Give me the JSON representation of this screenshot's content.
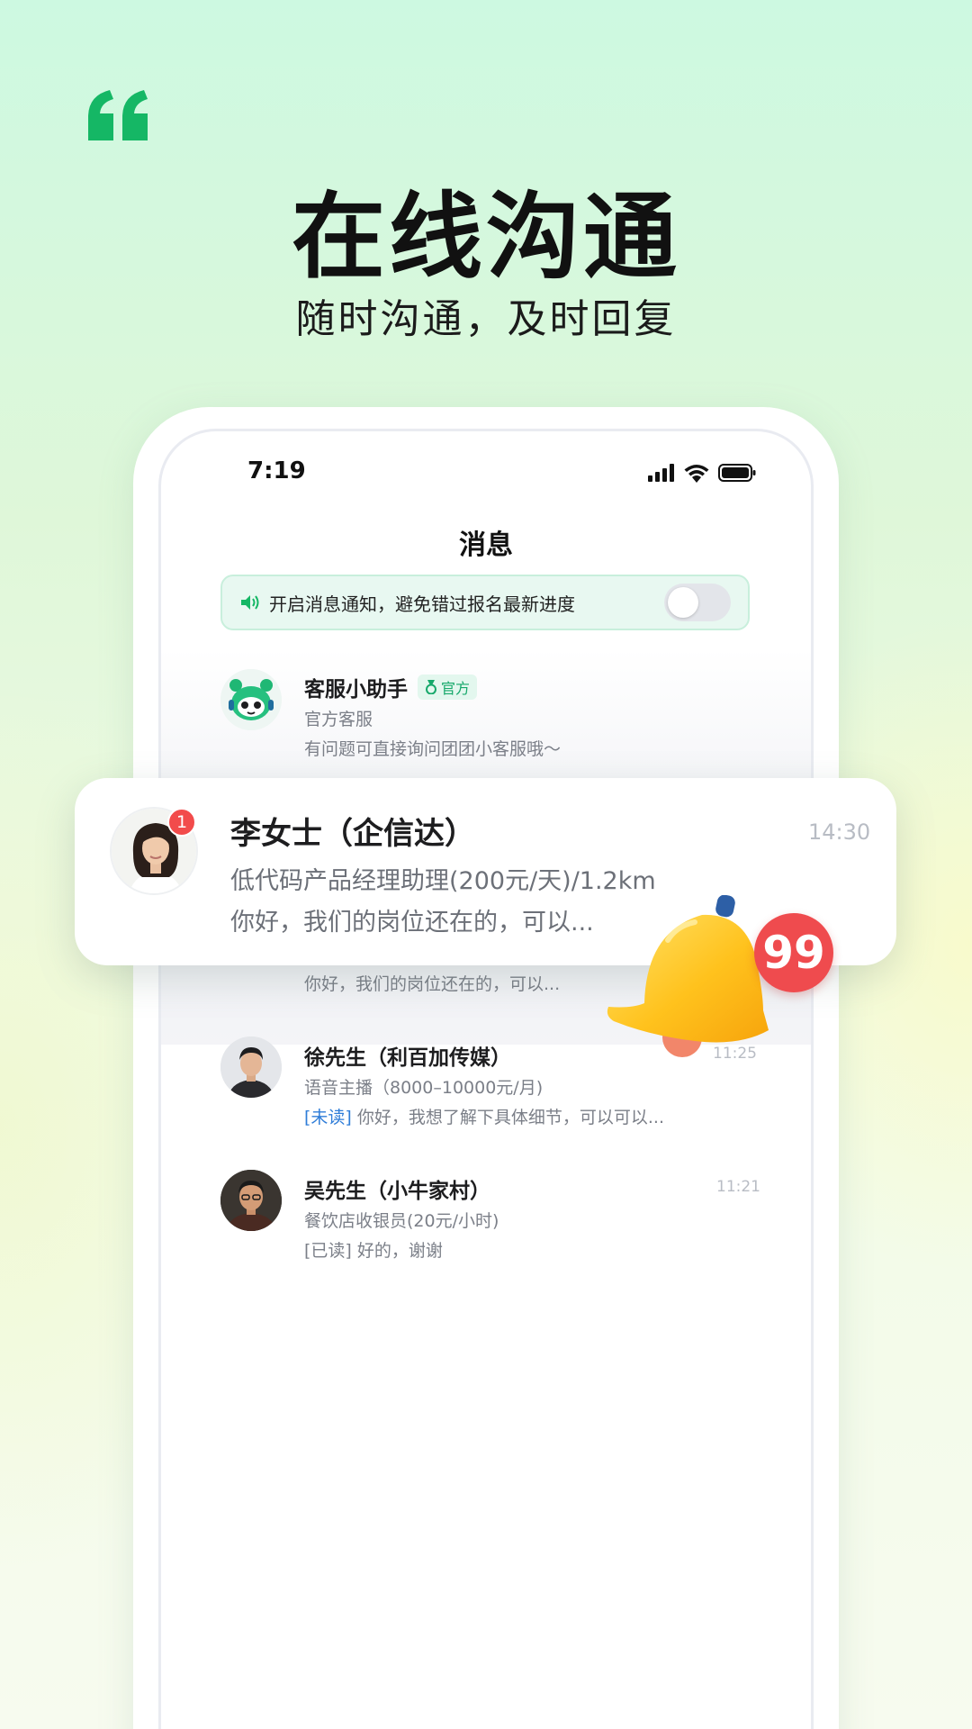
{
  "hero": {
    "title": "在线沟通",
    "subtitle": "随时沟通，及时回复"
  },
  "status_bar": {
    "time": "7:19"
  },
  "screen": {
    "title": "消息"
  },
  "notification_banner": {
    "text": "开启消息通知，避免错过报名最新进度",
    "toggle_on": false
  },
  "conversations": [
    {
      "name": "客服小助手",
      "badge": "官方",
      "subtitle": "官方客服",
      "message": "有问题可直接询问团团小客服哦～"
    },
    {
      "name": "李女士（企信达）",
      "job": "低代码产品经理助理(200元/天)/1.2km",
      "message": "你好，我们的岗位还在的，可以...",
      "time": "14:30",
      "unread_count": "1"
    },
    {
      "message_behind": "你好，我们的岗位还在的，可以..."
    },
    {
      "name": "徐先生（利百加传媒）",
      "job": "语音主播（8000–10000元/月)",
      "status_tag": "[未读]",
      "message": "你好，我想了解下具体细节，可以可以...",
      "time": "11:25"
    },
    {
      "name": "吴先生（小牛家村）",
      "job": "餐饮店收银员(20元/小时)",
      "status_tag": "[已读]",
      "message": "好的，谢谢",
      "time": "11:21"
    }
  ],
  "bell": {
    "icon": "bell-icon",
    "count": "99"
  },
  "colors": {
    "brand_green": "#15b765",
    "badge_red": "#ef4b4e",
    "unread_blue": "#2f7dd8"
  }
}
